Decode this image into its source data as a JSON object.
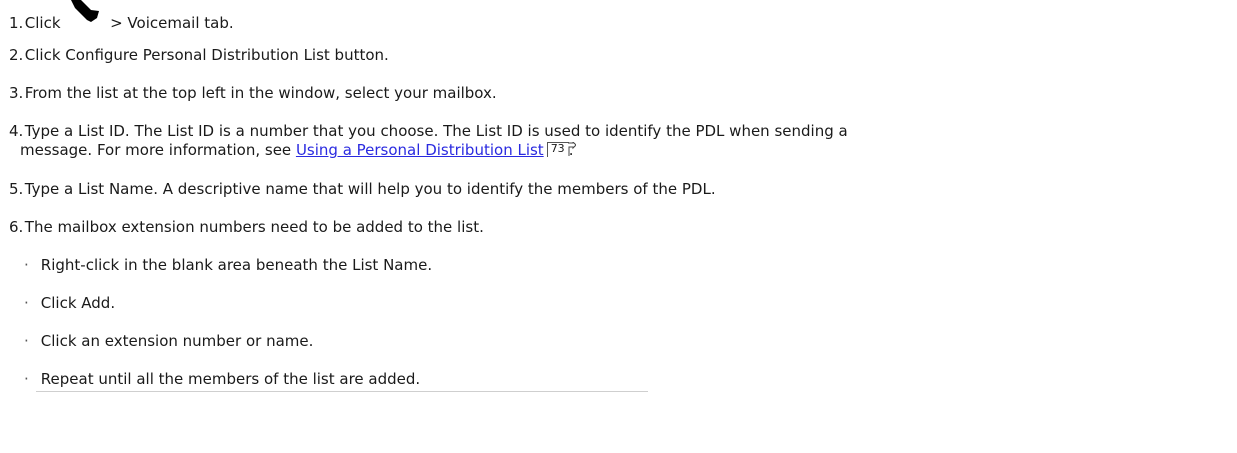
{
  "steps": [
    {
      "num": "1.",
      "pre": "Click",
      "post": "> Voicemail tab."
    },
    {
      "num": "2.",
      "text": "Click Configure Personal Distribution List button."
    },
    {
      "num": "3.",
      "text": "From the list at the top left in the window, select your mailbox."
    },
    {
      "num": "4.",
      "line1": "Type a List ID. The List ID is a number that you choose. The List ID is used to identify the PDL when sending a",
      "line2_pre": "message. For more information, see ",
      "link": "Using a Personal Distribution List",
      "xref_page": "73",
      "line2_post": "."
    },
    {
      "num": "5.",
      "text": "Type a List Name. A descriptive name that will help you to identify the members of the PDL."
    },
    {
      "num": "6.",
      "text": "The mailbox extension numbers need to be added to the list."
    }
  ],
  "bullets": [
    {
      "marker": "·",
      "text": "Right-click in the blank area beneath the List Name."
    },
    {
      "marker": "·",
      "text": "Click Add."
    },
    {
      "marker": "·",
      "text": "Click an extension number or name."
    },
    {
      "marker": "·",
      "text": "Repeat until all the members of the list are added."
    }
  ]
}
